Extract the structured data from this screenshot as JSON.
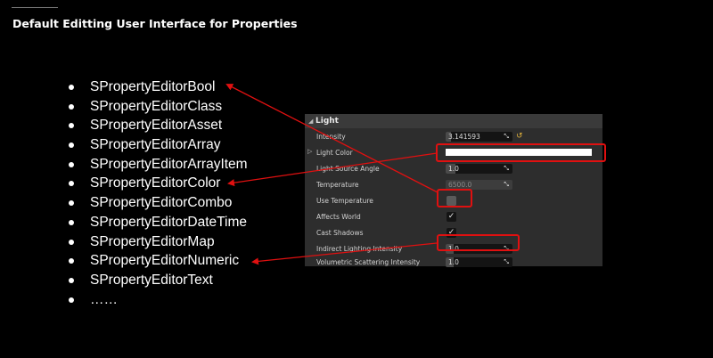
{
  "slide": {
    "title": "Default Editting User Interface for Properties"
  },
  "bullets": [
    "SPropertyEditorBool",
    "SPropertyEditorClass",
    "SPropertyEditorAsset",
    "SPropertyEditorArray",
    "SPropertyEditorArrayItem",
    "SPropertyEditorColor",
    "SPropertyEditorCombo",
    "SPropertyEditorDateTime",
    "SPropertyEditorMap",
    "SPropertyEditorNumeric",
    "SPropertyEditorText",
    "……"
  ],
  "panel": {
    "header": "Light",
    "rows": {
      "intensity": {
        "label": "Intensity",
        "value": "3.141593",
        "fraction": 0.08
      },
      "light_color": {
        "label": "Light Color",
        "color": "#ffffff"
      },
      "source_angle": {
        "label": "Light Source Angle",
        "value": "1.0",
        "fraction": 0.15
      },
      "temperature": {
        "label": "Temperature",
        "value": "6500.0"
      },
      "use_temperature": {
        "label": "Use Temperature",
        "checked": false
      },
      "affects_world": {
        "label": "Affects World",
        "checked": true
      },
      "cast_shadows": {
        "label": "Cast Shadows",
        "checked": true
      },
      "indirect": {
        "label": "Indirect Lighting Intensity",
        "value": "1.0",
        "fraction": 0.12
      },
      "volumetric": {
        "label": "Volumetric Scattering Intensity",
        "value": "1.0",
        "fraction": 0.12
      }
    }
  },
  "colors": {
    "highlight": "#e01010",
    "reset_arrow": "#e2b23b",
    "panel_bg": "#2d2d2d"
  }
}
